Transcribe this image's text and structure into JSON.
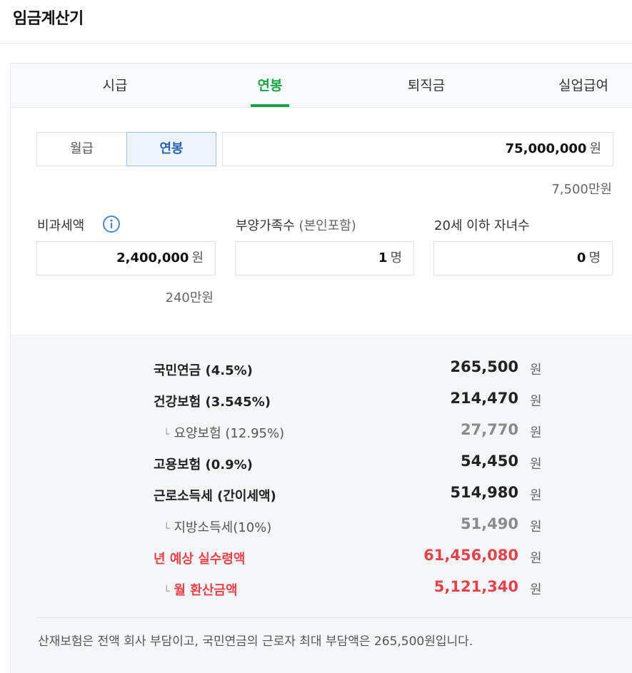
{
  "page": {
    "title": "임금계산기"
  },
  "tabs": [
    {
      "label": "시급"
    },
    {
      "label": "연봉"
    },
    {
      "label": "퇴직금"
    },
    {
      "label": "실업급여"
    }
  ],
  "pay_type": {
    "monthly": "월급",
    "annual": "연봉"
  },
  "salary": {
    "value": "75,000,000",
    "unit": "원",
    "hint": "7,500만원"
  },
  "fields": {
    "nontax": {
      "label": "비과세액",
      "value": "2,400,000",
      "unit": "원",
      "hint": "240만원"
    },
    "dependents": {
      "label": "부양가족수",
      "sub": "(본인포함)",
      "value": "1",
      "unit": "명"
    },
    "children": {
      "label": "20세 이하 자녀수",
      "value": "0",
      "unit": "명"
    }
  },
  "results": [
    {
      "name": "국민연금",
      "rate": "(4.5%)",
      "amount": "265,500",
      "unit": "원"
    },
    {
      "name": "건강보험",
      "rate": "(3.545%)",
      "amount": "214,470",
      "unit": "원"
    },
    {
      "name": "요양보험",
      "rate": "(12.95%)",
      "amount": "27,770",
      "unit": "원"
    },
    {
      "name": "고용보험",
      "rate": "(0.9%)",
      "amount": "54,450",
      "unit": "원"
    },
    {
      "name": "근로소득세",
      "rate": "(간이세액)",
      "amount": "514,980",
      "unit": "원"
    },
    {
      "name": "지방소득세",
      "rate": "(10%)",
      "amount": "51,490",
      "unit": "원"
    },
    {
      "name": "년 예상 실수령액",
      "rate": "",
      "amount": "61,456,080",
      "unit": "원"
    },
    {
      "name": "월 환산금액",
      "rate": "",
      "amount": "5,121,340",
      "unit": "원"
    }
  ],
  "note": "산재보험은 전액 회사 부담이고, 국민연금의 근로자 최대 부담액은 265,500원입니다.",
  "colors": {
    "accent_green": "#1aa34a",
    "accent_red": "#e5434b",
    "accent_blue": "#2a62b0"
  },
  "icons": {
    "info": "info-circle-icon",
    "sub_marker": "sub-item-corner-icon"
  }
}
